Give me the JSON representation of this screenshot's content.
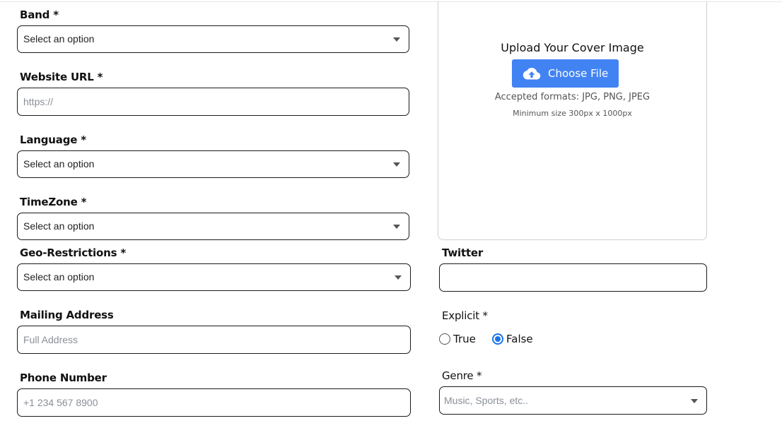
{
  "form": {
    "band": {
      "label": "Band *",
      "value": "Select an option"
    },
    "website": {
      "label": "Website URL *",
      "placeholder": "https://"
    },
    "language": {
      "label": "Language *",
      "value": "Select an option"
    },
    "timezone": {
      "label": "TimeZone *",
      "value": "Select an option"
    },
    "geo": {
      "label": "Geo-Restrictions *",
      "value": "Select an option"
    },
    "mailing": {
      "label": "Mailing Address",
      "placeholder": "Full Address"
    },
    "phone": {
      "label": "Phone Number",
      "placeholder": "+1 234 567 8900"
    },
    "twitter": {
      "label": "Twitter",
      "value": ""
    },
    "explicit": {
      "label": "Explicit *",
      "options": [
        {
          "label": "True",
          "checked": false
        },
        {
          "label": "False",
          "checked": true
        }
      ]
    },
    "genre": {
      "label": "Genre *",
      "placeholder": "Music, Sports, etc.."
    }
  },
  "upload": {
    "title": "Upload Your Cover Image",
    "button_label": "Choose File",
    "button_icon": "cloud-upload-icon",
    "formats": "Accepted formats: JPG, PNG, JPEG",
    "min_size": "Minimum size 300px x 1000px"
  },
  "colors": {
    "accent": "#4283f3",
    "radio_checked": "#1a73e8",
    "border": "#1a1a1a",
    "placeholder": "#8a8f98"
  }
}
